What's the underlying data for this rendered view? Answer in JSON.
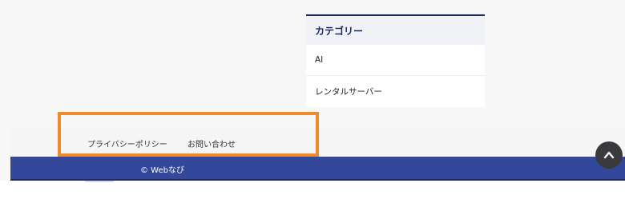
{
  "sidebar": {
    "category_widget": {
      "title": "カテゴリー",
      "items": [
        {
          "label": "AI"
        },
        {
          "label": "レンタルサーバー"
        }
      ]
    }
  },
  "footer": {
    "links": [
      {
        "label": "プライバシーポリシー"
      },
      {
        "label": "お問い合わせ"
      }
    ],
    "copyright": "© Webなび"
  },
  "back_to_top": {
    "icon": "chevron-up-icon"
  },
  "colors": {
    "accent": "#33479b",
    "title_text": "#1d2a62",
    "highlight": "#f08a2e",
    "back_to_top_bg": "#3a3a3e"
  }
}
